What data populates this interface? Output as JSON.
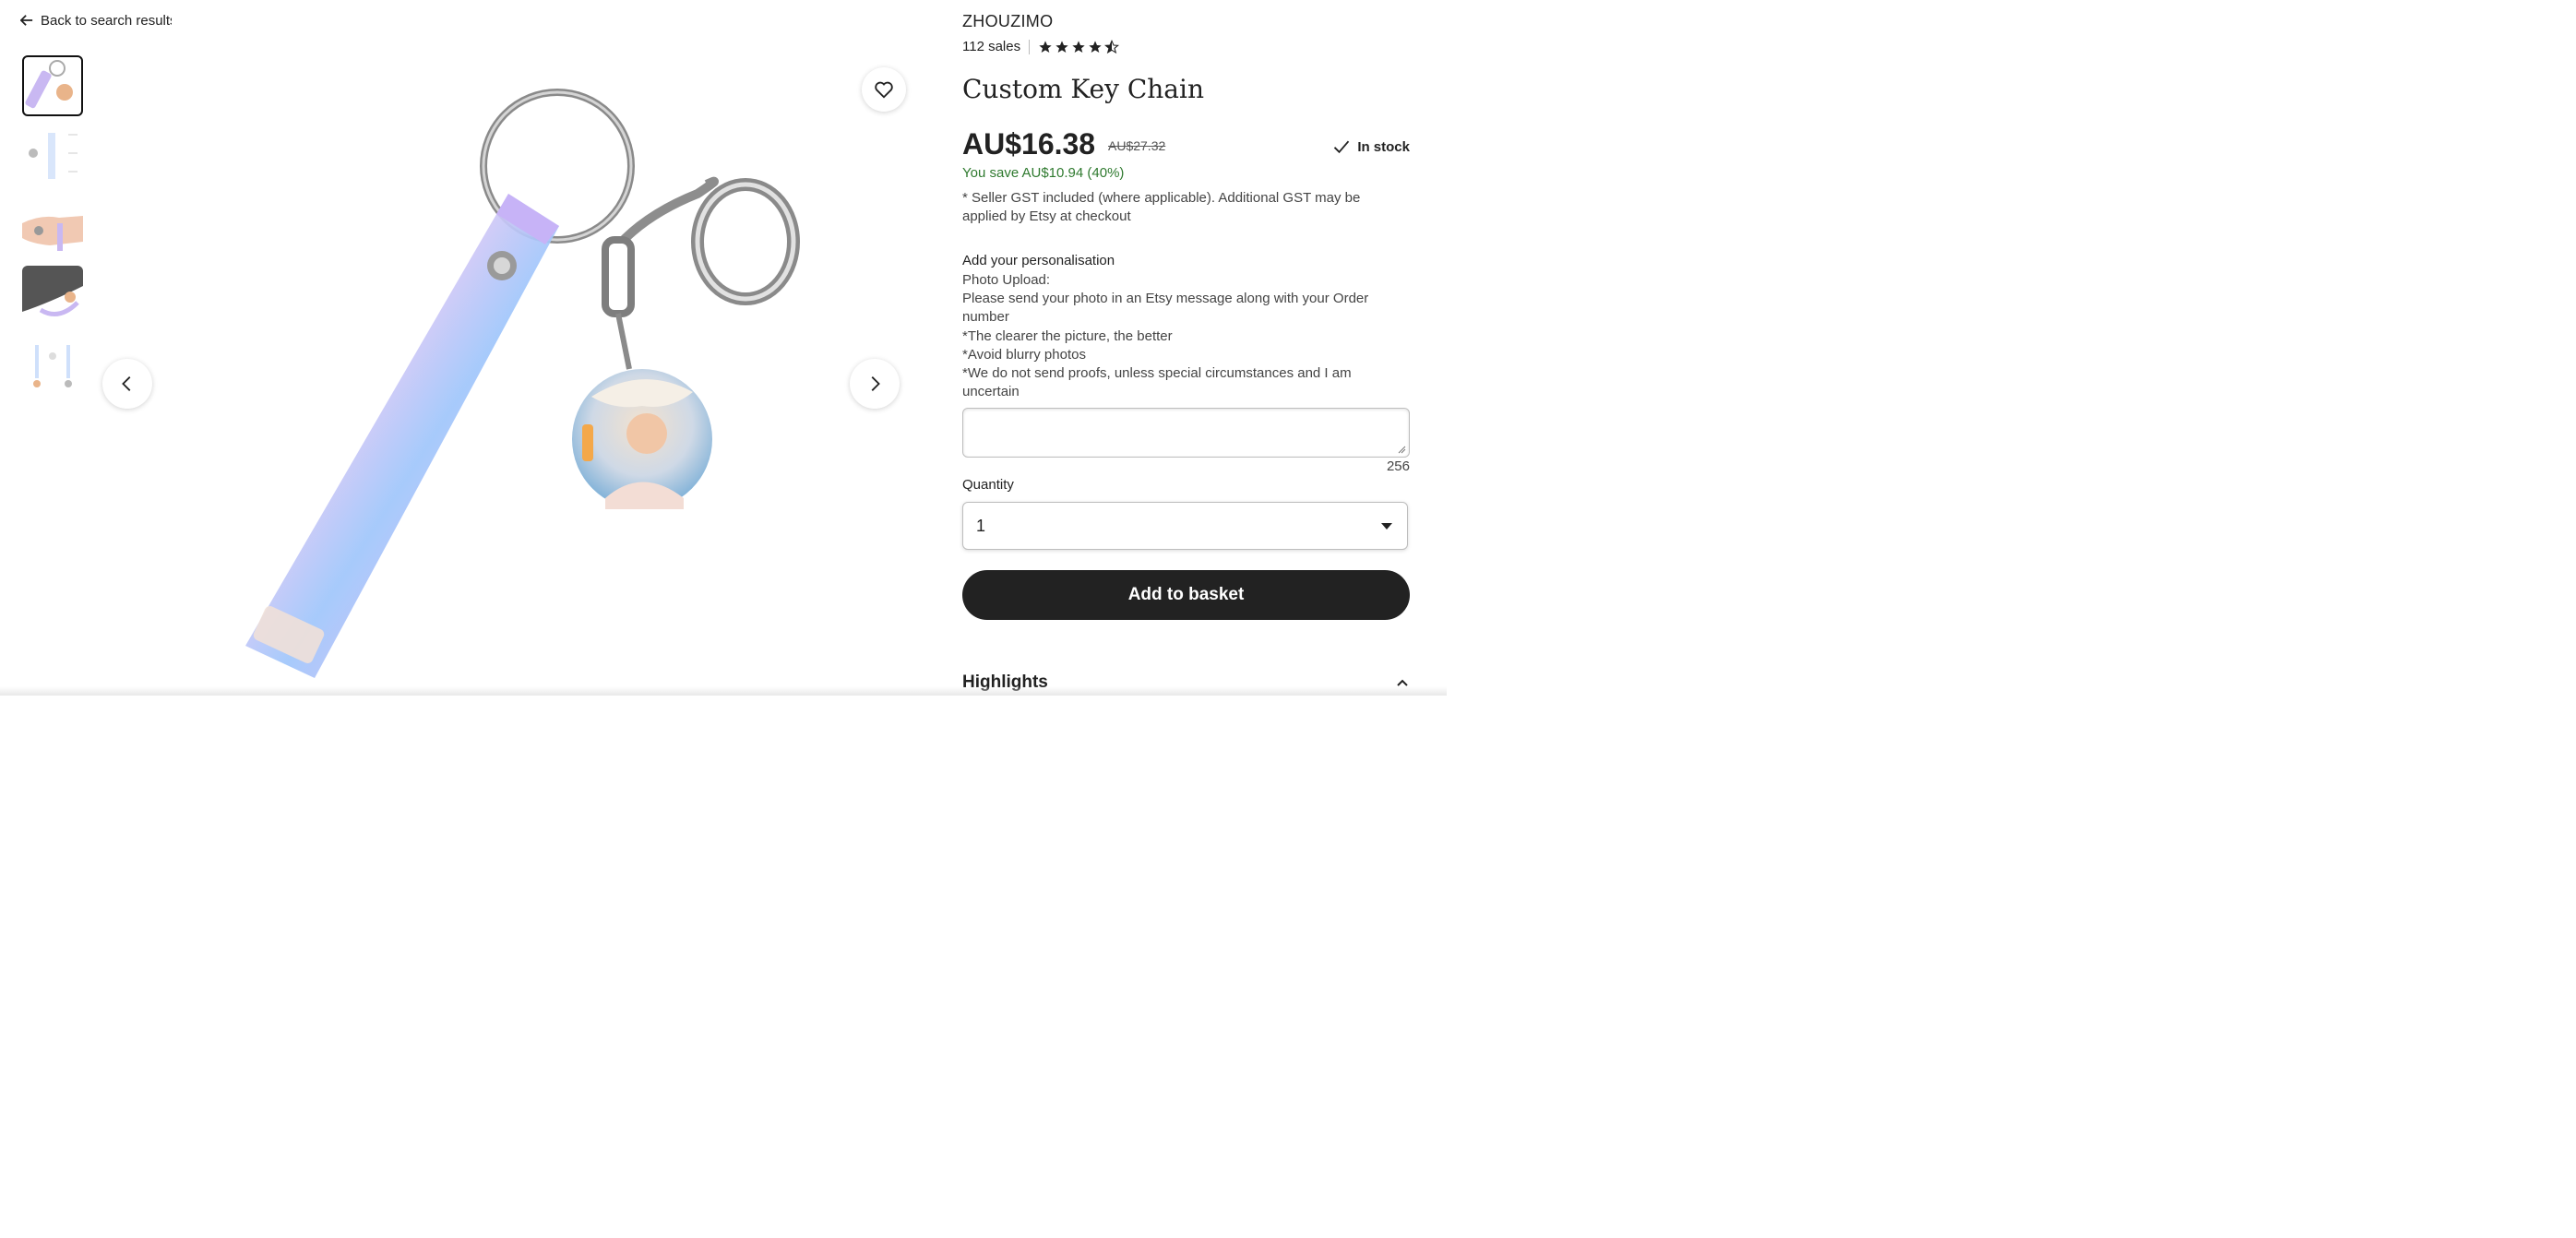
{
  "nav": {
    "back_label": "Back to search results"
  },
  "gallery": {
    "thumbnail_count": 5,
    "active_index": 0
  },
  "product": {
    "shop_name": "ZHOUZIMO",
    "sales": "112 sales",
    "rating": 4.5,
    "title": "Custom Key Chain",
    "price": "AU$16.38",
    "original_price": "AU$27.32",
    "stock_label": "In stock",
    "savings": "You save AU$10.94 (40%)",
    "gst_note": "* Seller GST included (where applicable). Additional GST may be applied by Etsy at checkout"
  },
  "personalisation": {
    "title": "Add your personalisation",
    "lines": [
      "Photo Upload:",
      "Please send your photo in an Etsy message along with your Order number",
      "*The clearer the picture, the better",
      "*Avoid blurry photos",
      "*We do not send proofs, unless special circumstances and I am uncertain"
    ],
    "value": "",
    "char_count": "256"
  },
  "quantity": {
    "label": "Quantity",
    "selected": "1"
  },
  "actions": {
    "add_to_basket": "Add to basket"
  },
  "highlights": {
    "label": "Highlights"
  },
  "colors": {
    "accent_dark": "#222222",
    "savings_green": "#2f7a2f",
    "strap": "#c9b8f2"
  }
}
